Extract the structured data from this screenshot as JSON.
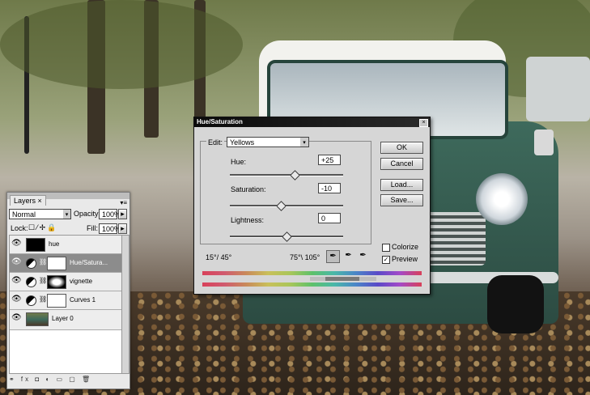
{
  "layers_panel": {
    "tab_label": "Layers",
    "tab_close": "×",
    "blend_mode": "Normal",
    "opacity_label": "Opacity:",
    "opacity_value": "100%",
    "lock_label": "Lock:",
    "fill_label": "Fill:",
    "fill_value": "100%",
    "layers": [
      {
        "name": "hue",
        "selected": false
      },
      {
        "name": "Hue/Satura...",
        "selected": true
      },
      {
        "name": "vignette",
        "selected": false
      },
      {
        "name": "Curves 1",
        "selected": false
      },
      {
        "name": "Layer 0",
        "selected": false
      }
    ]
  },
  "hue_saturation_dialog": {
    "title": "Hue/Saturation",
    "close_glyph": "×",
    "edit_label": "Edit:",
    "edit_value": "Yellows",
    "hue_label": "Hue:",
    "hue_value": "+25",
    "saturation_label": "Saturation:",
    "saturation_value": "-10",
    "lightness_label": "Lightness:",
    "lightness_value": "0",
    "range_left": "15°/ 45°",
    "range_right": "75°\\ 105°",
    "ok_label": "OK",
    "cancel_label": "Cancel",
    "load_label": "Load...",
    "save_label": "Save...",
    "colorize_label": "Colorize",
    "colorize_checked": false,
    "preview_label": "Preview",
    "preview_checked": true,
    "hue_level": 0.57,
    "saturation_level": 0.45,
    "lightness_level": 0.5
  },
  "icons": [
    "eye-icon",
    "adjustment-layer-icon",
    "chain-link-icon",
    "eyedropper-icon",
    "eyedropper-plus-icon",
    "eyedropper-minus-icon",
    "close-icon",
    "dropdown-arrow-icon"
  ]
}
